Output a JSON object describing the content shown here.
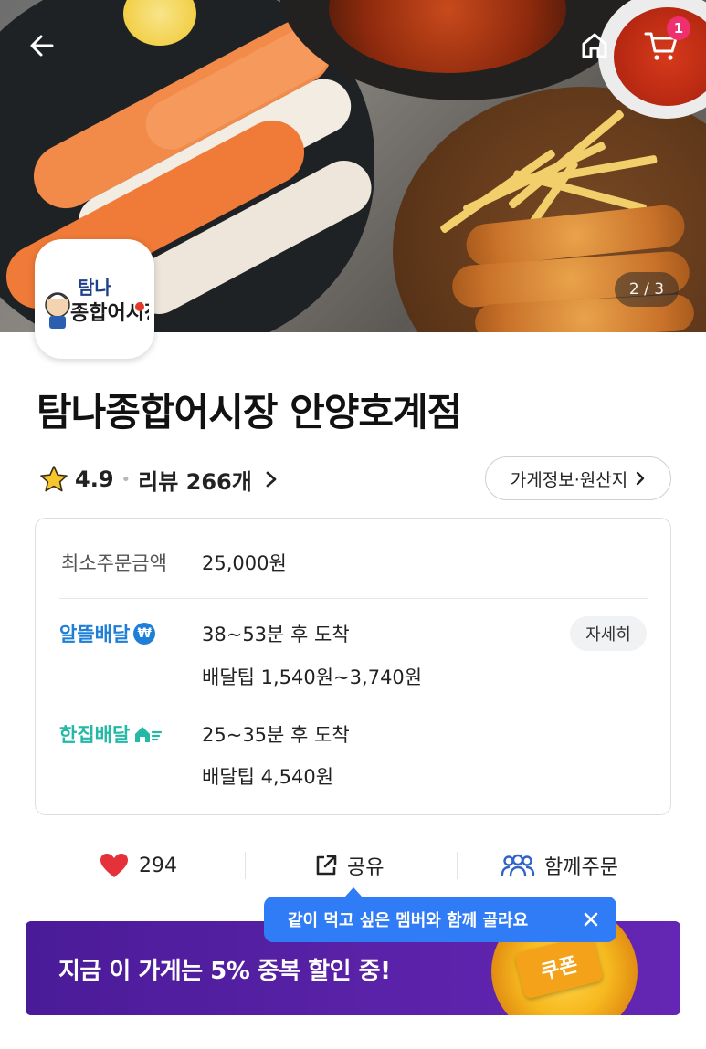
{
  "header": {
    "cart_count": "1",
    "image_pager": "2 / 3"
  },
  "logo": {
    "text_line1": "탐나",
    "text_line2": "종합어시장"
  },
  "store": {
    "name": "탐나종합어시장 안양호계점",
    "rating": "4.9",
    "reviews_label": "리뷰 266개",
    "info_button_label": "가게정보·원산지"
  },
  "order_info": {
    "min_order_label": "최소주문금액",
    "min_order_value": "25,000원",
    "alttle": {
      "label": "알뜰배달",
      "eta": "38~53분 후 도착",
      "tip": "배달팁 1,540원~3,740원",
      "detail_button": "자세히"
    },
    "hanjip": {
      "label": "한집배달",
      "eta": "25~35분 후 도착",
      "tip": "배달팁 4,540원"
    }
  },
  "actions": {
    "likes": "294",
    "share": "공유",
    "group_order": "함께주문"
  },
  "tooltip": {
    "text": "같이 먹고 싶은 멤버와 함께 골라요"
  },
  "banner": {
    "text": "지금 이 가게는 5% 중복 할인 중!",
    "coupon_label": "쿠폰"
  },
  "colors": {
    "brand_blue": "#1e7fd8",
    "hanjip_teal": "#23b9a6",
    "heart_red": "#e5323a",
    "banner_purple": "#4a1b98",
    "tooltip_blue": "#2f7cf6",
    "badge_pink": "#ef2f6e"
  },
  "icons": [
    "back-arrow-icon",
    "home-icon",
    "cart-icon",
    "star-icon",
    "chevron-right-icon",
    "won-badge-icon",
    "house-speed-icon",
    "heart-icon",
    "share-icon",
    "group-icon",
    "close-icon"
  ]
}
